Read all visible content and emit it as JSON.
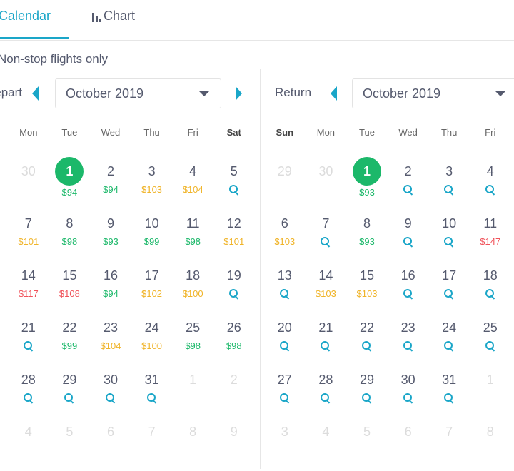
{
  "tabs": {
    "calendar": "Calendar",
    "chart": "Chart"
  },
  "filter": "Non-stop flights only",
  "colors": {
    "accent": "#1aa6c8",
    "cheap": "#1cb86a",
    "mid": "#f0b429",
    "expensive": "#f0525a"
  },
  "depart": {
    "label": "Depart",
    "month": "October 2019",
    "weekdays": [
      "Mon",
      "Tue",
      "Wed",
      "Thu",
      "Fri",
      "Sat"
    ],
    "weeks": [
      [
        {
          "d": "30",
          "s": "muted"
        },
        {
          "d": "1",
          "s": "selected",
          "p": "$94",
          "c": "green"
        },
        {
          "d": "2",
          "p": "$94",
          "c": "green"
        },
        {
          "d": "3",
          "p": "$103",
          "c": "yellow"
        },
        {
          "d": "4",
          "p": "$104",
          "c": "yellow"
        },
        {
          "d": "5",
          "search": true
        }
      ],
      [
        {
          "d": "7",
          "p": "$101",
          "c": "yellow"
        },
        {
          "d": "8",
          "p": "$98",
          "c": "green"
        },
        {
          "d": "9",
          "p": "$93",
          "c": "green"
        },
        {
          "d": "10",
          "p": "$99",
          "c": "green"
        },
        {
          "d": "11",
          "p": "$98",
          "c": "green"
        },
        {
          "d": "12",
          "p": "$101",
          "c": "yellow"
        }
      ],
      [
        {
          "d": "14",
          "p": "$117",
          "c": "red"
        },
        {
          "d": "15",
          "p": "$108",
          "c": "red"
        },
        {
          "d": "16",
          "p": "$94",
          "c": "green"
        },
        {
          "d": "17",
          "p": "$102",
          "c": "yellow"
        },
        {
          "d": "18",
          "p": "$100",
          "c": "yellow"
        },
        {
          "d": "19",
          "search": true
        }
      ],
      [
        {
          "d": "21",
          "search": true
        },
        {
          "d": "22",
          "p": "$99",
          "c": "green"
        },
        {
          "d": "23",
          "p": "$104",
          "c": "yellow"
        },
        {
          "d": "24",
          "p": "$100",
          "c": "yellow"
        },
        {
          "d": "25",
          "p": "$98",
          "c": "green"
        },
        {
          "d": "26",
          "p": "$98",
          "c": "green"
        }
      ],
      [
        {
          "d": "28",
          "search": true
        },
        {
          "d": "29",
          "search": true
        },
        {
          "d": "30",
          "search": true
        },
        {
          "d": "31",
          "search": true
        },
        {
          "d": "1",
          "s": "muted"
        },
        {
          "d": "2",
          "s": "muted"
        }
      ],
      [
        {
          "d": "4",
          "s": "muted"
        },
        {
          "d": "5",
          "s": "muted"
        },
        {
          "d": "6",
          "s": "muted"
        },
        {
          "d": "7",
          "s": "muted"
        },
        {
          "d": "8",
          "s": "muted"
        },
        {
          "d": "9",
          "s": "muted"
        }
      ]
    ]
  },
  "return": {
    "label": "Return",
    "month": "October 2019",
    "weekdays": [
      "Sun",
      "Mon",
      "Tue",
      "Wed",
      "Thu",
      "Fri"
    ],
    "weeks": [
      [
        {
          "d": "29",
          "s": "muted"
        },
        {
          "d": "30",
          "s": "muted"
        },
        {
          "d": "1",
          "s": "selected",
          "p": "$93",
          "c": "green"
        },
        {
          "d": "2",
          "search": true
        },
        {
          "d": "3",
          "search": true
        },
        {
          "d": "4",
          "search": true
        }
      ],
      [
        {
          "d": "6",
          "p": "$103",
          "c": "yellow"
        },
        {
          "d": "7",
          "search": true
        },
        {
          "d": "8",
          "p": "$93",
          "c": "green"
        },
        {
          "d": "9",
          "search": true
        },
        {
          "d": "10",
          "search": true
        },
        {
          "d": "11",
          "p": "$147",
          "c": "red"
        }
      ],
      [
        {
          "d": "13",
          "search": true
        },
        {
          "d": "14",
          "p": "$103",
          "c": "yellow"
        },
        {
          "d": "15",
          "p": "$103",
          "c": "yellow"
        },
        {
          "d": "16",
          "search": true
        },
        {
          "d": "17",
          "search": true
        },
        {
          "d": "18",
          "search": true
        }
      ],
      [
        {
          "d": "20",
          "search": true
        },
        {
          "d": "21",
          "search": true
        },
        {
          "d": "22",
          "search": true
        },
        {
          "d": "23",
          "search": true
        },
        {
          "d": "24",
          "search": true
        },
        {
          "d": "25",
          "search": true
        }
      ],
      [
        {
          "d": "27",
          "search": true
        },
        {
          "d": "28",
          "search": true
        },
        {
          "d": "29",
          "search": true
        },
        {
          "d": "30",
          "search": true
        },
        {
          "d": "31",
          "search": true
        },
        {
          "d": "1",
          "s": "muted"
        }
      ],
      [
        {
          "d": "3",
          "s": "muted"
        },
        {
          "d": "4",
          "s": "muted"
        },
        {
          "d": "5",
          "s": "muted"
        },
        {
          "d": "6",
          "s": "muted"
        },
        {
          "d": "7",
          "s": "muted"
        },
        {
          "d": "8",
          "s": "muted"
        }
      ]
    ]
  }
}
